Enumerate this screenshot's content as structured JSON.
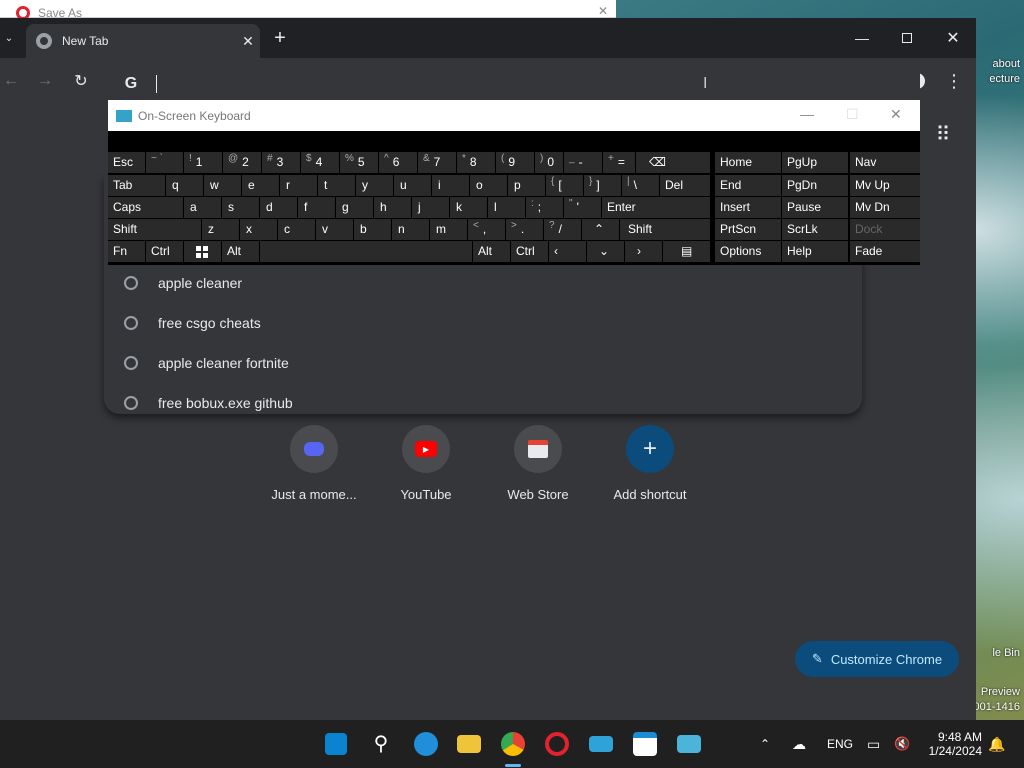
{
  "bgwin": {
    "title": "Save As"
  },
  "desktop": {
    "text1": "about",
    "text2": "ecture",
    "text3": "le Bin",
    "text4": "Preview",
    "text5": "001-1416"
  },
  "chrome": {
    "tab_title": "New Tab",
    "customize_label": "Customize Chrome"
  },
  "suggestions": [
    "apple cleaner",
    "free csgo cheats",
    "apple cleaner fortnite",
    "free bobux.exe github"
  ],
  "shortcuts": [
    "Just a mome...",
    "YouTube",
    "Web Store",
    "Add shortcut"
  ],
  "osk": {
    "title": "On-Screen Keyboard",
    "keys": {
      "esc": "Esc",
      "tilde": "~ `",
      "k1": "1",
      "k2": "2",
      "k3": "3",
      "k4": "4",
      "k5": "5",
      "k6": "6",
      "k7": "7",
      "k8": "8",
      "k9": "9",
      "k0": "0",
      "minus": "-",
      "equals": "=",
      "home": "Home",
      "pgup": "PgUp",
      "nav": "Nav",
      "tab": "Tab",
      "q": "q",
      "w": "w",
      "e": "e",
      "r": "r",
      "t": "t",
      "y": "y",
      "u": "u",
      "i": "i",
      "o": "o",
      "p": "p",
      "lbr": "[",
      "rbr": "]",
      "bsl": "\\",
      "del": "Del",
      "end": "End",
      "pgdn": "PgDn",
      "mvup": "Mv Up",
      "caps": "Caps",
      "a": "a",
      "s": "s",
      "d": "d",
      "f": "f",
      "g": "g",
      "h": "h",
      "j": "j",
      "k": "k",
      "l": "l",
      "semi": ";",
      "quote": "'",
      "enter": "Enter",
      "insert": "Insert",
      "pause": "Pause",
      "mvdn": "Mv Dn",
      "shift": "Shift",
      "z": "z",
      "x": "x",
      "c": "c",
      "v": "v",
      "b": "b",
      "n": "n",
      "m": "m",
      "comma": ",",
      "period": ".",
      "slash": "/",
      "prtscn": "PrtScn",
      "scrlk": "ScrLk",
      "dock": "Dock",
      "fn": "Fn",
      "ctrl": "Ctrl",
      "alt": "Alt",
      "options": "Options",
      "help": "Help",
      "fade": "Fade"
    },
    "shift": {
      "k1": "!",
      "k2": "@",
      "k3": "#",
      "k4": "$",
      "k5": "%",
      "k6": "^",
      "k7": "&",
      "k8": "*",
      "k9": "(",
      "k0": ")",
      "minus": "_",
      "equals": "+",
      "lbr": "{",
      "rbr": "}",
      "bsl": "|",
      "semi": ":",
      "quote": "\"",
      "comma": "<",
      "period": ">",
      "slash": "?"
    }
  },
  "taskbar": {
    "lang": "ENG",
    "time": "9:48 AM",
    "date": "1/24/2024"
  }
}
